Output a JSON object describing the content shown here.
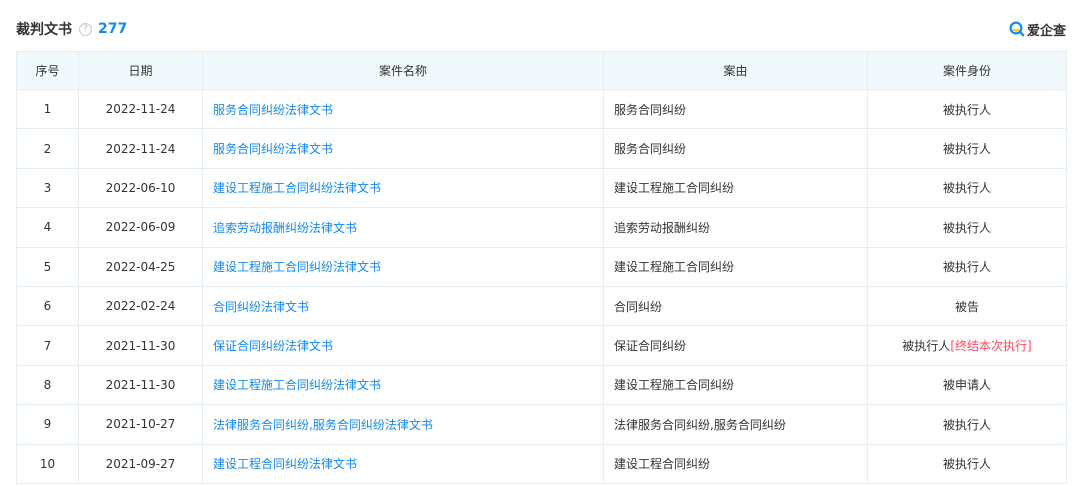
{
  "header": {
    "title": "裁判文书",
    "help_icon": "?",
    "count": "277",
    "logo_text": "爱企查",
    "logo_color": "#128bed"
  },
  "table": {
    "columns": [
      "序号",
      "日期",
      "案件名称",
      "案由",
      "案件身份"
    ],
    "rows": [
      {
        "index": "1",
        "date": "2022-11-24",
        "case_name": "服务合同纠纷法律文书",
        "cause": "服务合同纠纷",
        "role": "被执行人",
        "status": ""
      },
      {
        "index": "2",
        "date": "2022-11-24",
        "case_name": "服务合同纠纷法律文书",
        "cause": "服务合同纠纷",
        "role": "被执行人",
        "status": ""
      },
      {
        "index": "3",
        "date": "2022-06-10",
        "case_name": "建设工程施工合同纠纷法律文书",
        "cause": "建设工程施工合同纠纷",
        "role": "被执行人",
        "status": ""
      },
      {
        "index": "4",
        "date": "2022-06-09",
        "case_name": "追索劳动报酬纠纷法律文书",
        "cause": "追索劳动报酬纠纷",
        "role": "被执行人",
        "status": ""
      },
      {
        "index": "5",
        "date": "2022-04-25",
        "case_name": "建设工程施工合同纠纷法律文书",
        "cause": "建设工程施工合同纠纷",
        "role": "被执行人",
        "status": ""
      },
      {
        "index": "6",
        "date": "2022-02-24",
        "case_name": "合同纠纷法律文书",
        "cause": "合同纠纷",
        "role": "被告",
        "status": ""
      },
      {
        "index": "7",
        "date": "2021-11-30",
        "case_name": "保证合同纠纷法律文书",
        "cause": "保证合同纠纷",
        "role": "被执行人",
        "status": "[终结本次执行]"
      },
      {
        "index": "8",
        "date": "2021-11-30",
        "case_name": "建设工程施工合同纠纷法律文书",
        "cause": "建设工程施工合同纠纷",
        "role": "被申请人",
        "status": ""
      },
      {
        "index": "9",
        "date": "2021-10-27",
        "case_name": "法律服务合同纠纷,服务合同纠纷法律文书",
        "cause": "法律服务合同纠纷,服务合同纠纷",
        "role": "被执行人",
        "status": ""
      },
      {
        "index": "10",
        "date": "2021-09-27",
        "case_name": "建设工程合同纠纷法律文书",
        "cause": "建设工程合同纠纷",
        "role": "被执行人",
        "status": ""
      }
    ]
  },
  "colors": {
    "link": "#128bed",
    "status": "#fd485e",
    "header_bg": "#f2f9fc",
    "border": "#e4eef6"
  }
}
